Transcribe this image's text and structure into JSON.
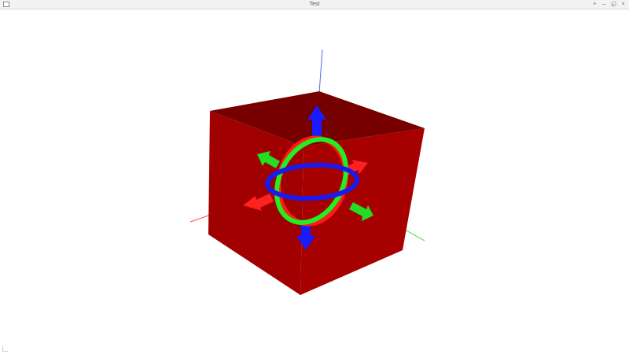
{
  "window": {
    "title": "Test",
    "controls": {
      "pin": "+",
      "minimize": "–",
      "maximize": "◱",
      "close": "×"
    }
  },
  "scene": {
    "object": "cube",
    "cube_color": "#a00000",
    "gizmo": {
      "translate_x_color": "#ff2020",
      "translate_y_color": "#22dd22",
      "translate_z_color": "#1a1aff",
      "rotate_x_color": "#ff1a1a",
      "rotate_y_color": "#22ee22",
      "rotate_z_color": "#1a1aee"
    },
    "axes": {
      "x_color": "#ff4444",
      "y_color": "#44dd44",
      "z_color": "#4444ff"
    }
  }
}
